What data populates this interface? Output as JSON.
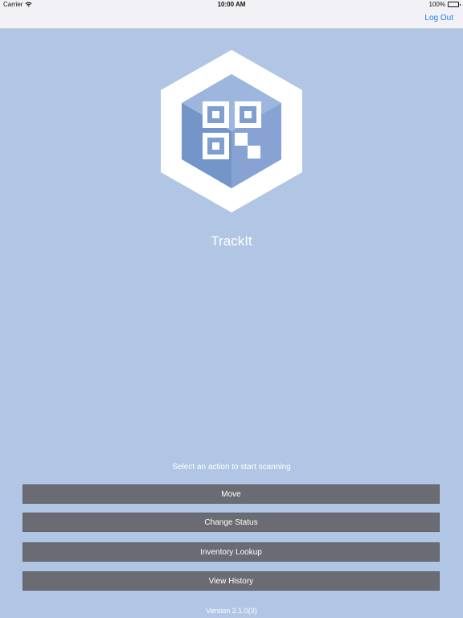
{
  "status_bar": {
    "carrier": "Carrier",
    "time": "10:00 AM",
    "battery": "100%",
    "battery_level": 1.0
  },
  "nav": {
    "logout_label": "Log Out"
  },
  "app": {
    "title": "TrackIt",
    "logo_icon": "hexagon-qr-cube-icon"
  },
  "prompt": "Select an action to start scanning",
  "actions": [
    {
      "label": "Move"
    },
    {
      "label": "Change Status"
    },
    {
      "label": "Inventory Lookup"
    },
    {
      "label": "View History"
    }
  ],
  "version": "Version 2.1.0(3)",
  "colors": {
    "background": "#b1c6e4",
    "button": "#6b6b73",
    "link": "#1c7ef0",
    "cube_light": "#8fabd8",
    "cube_dark": "#7395c9"
  }
}
